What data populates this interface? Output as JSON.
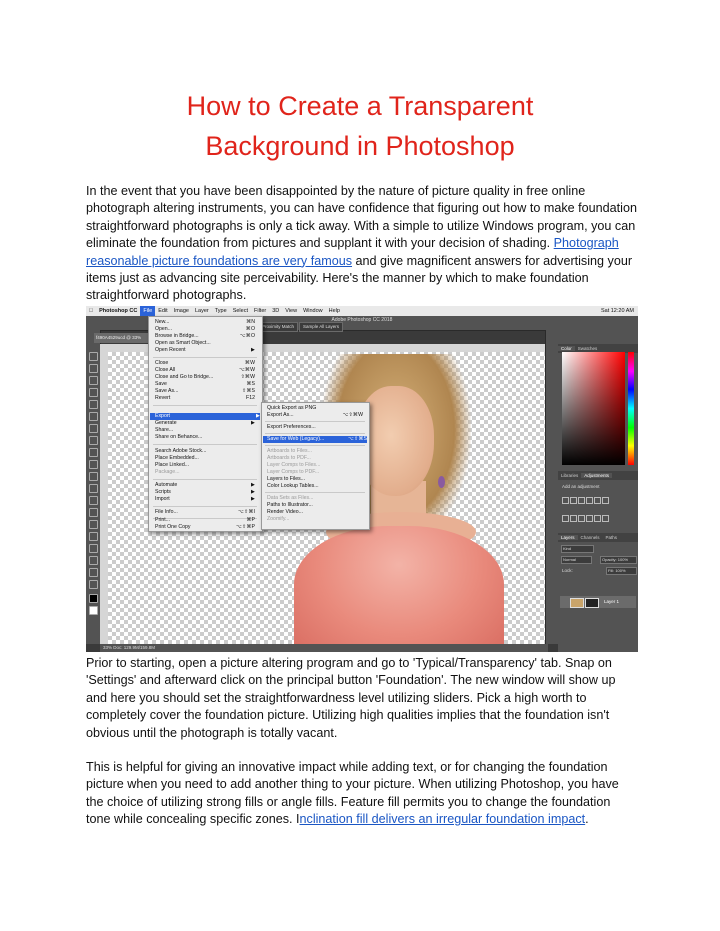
{
  "title_line1": "How to Create a Transparent",
  "title_line2": "Background in Photoshop",
  "para1": {
    "before_link": "In the event that you have been disappointed by the nature of picture quality in free online photograph altering instruments, you can have confidence that figuring out how to make foundation straightforward photographs is only a tick away. With a simple to utilize Windows program, you can eliminate the foundation from pictures and supplant it with your decision of shading. ",
    "link": "Photograph reasonable picture foundations are very famous",
    "after_link": " and give magnificent answers for advertising your items just as advancing site perceivability. Here's the manner by which to make foundation straightforward photographs."
  },
  "para2": "Prior to starting, open a picture altering program and go to 'Typical/Transparency' tab. Snap on 'Settings' and afterward click on the principal button 'Foundation'. The new window will show up and here you should set the straightforwardness level utilizing sliders. Pick a high worth to completely cover the foundation picture. Utilizing high qualities implies that the foundation isn't obvious until the photograph is totally vacant.",
  "para3": {
    "before_link": "This is helpful for giving an innovative impact while adding text, or for changing the foundation picture when you need to add another thing to your picture. When utilizing Photoshop, you have the choice of utilizing strong fills or angle fills. Feature fill permits you to change the foundation tone while concealing specific zones. I",
    "link": "nclination fill delivers an irregular foundation impact",
    "after_link": "."
  },
  "screenshot": {
    "menubar": [
      "Photoshop CC",
      "File",
      "Edit",
      "Image",
      "Layer",
      "Type",
      "Select",
      "Filter",
      "3D",
      "View",
      "Window",
      "Help"
    ],
    "clock": "Sat 12:20 AM",
    "window_title": "Adobe Photoshop CC 2018",
    "opt_proximity": "Proximity Match",
    "opt_sample": "Sample All Layers",
    "doc_tab": "f490A4529ucd @ 33%",
    "status": "33%    Doc: 129.9M/159.8M",
    "file_menu": [
      {
        "label": "New...",
        "shortcut": "⌘N"
      },
      {
        "label": "Open...",
        "shortcut": "⌘O"
      },
      {
        "label": "Browse in Bridge...",
        "shortcut": "⌥⌘O"
      },
      {
        "label": "Open as Smart Object...",
        "shortcut": ""
      },
      {
        "label": "Open Recent",
        "shortcut": "▶"
      },
      {
        "label": "Close",
        "shortcut": "⌘W"
      },
      {
        "label": "Close All",
        "shortcut": "⌥⌘W"
      },
      {
        "label": "Close and Go to Bridge...",
        "shortcut": "⇧⌘W"
      },
      {
        "label": "Save",
        "shortcut": "⌘S"
      },
      {
        "label": "Save As...",
        "shortcut": "⇧⌘S"
      },
      {
        "label": "Revert",
        "shortcut": "F12"
      },
      {
        "label": "Export",
        "shortcut": "▶"
      },
      {
        "label": "Generate",
        "shortcut": "▶"
      },
      {
        "label": "Share...",
        "shortcut": ""
      },
      {
        "label": "Share on Behance...",
        "shortcut": ""
      },
      {
        "label": "Search Adobe Stock...",
        "shortcut": ""
      },
      {
        "label": "Place Embedded...",
        "shortcut": ""
      },
      {
        "label": "Place Linked...",
        "shortcut": ""
      },
      {
        "label": "Package...",
        "shortcut": ""
      },
      {
        "label": "Automate",
        "shortcut": "▶"
      },
      {
        "label": "Scripts",
        "shortcut": "▶"
      },
      {
        "label": "Import",
        "shortcut": "▶"
      },
      {
        "label": "File Info...",
        "shortcut": "⌥⇧⌘I"
      },
      {
        "label": "Print...",
        "shortcut": "⌘P"
      },
      {
        "label": "Print One Copy",
        "shortcut": "⌥⇧⌘P"
      }
    ],
    "export_menu": [
      {
        "label": "Quick Export as PNG",
        "shortcut": ""
      },
      {
        "label": "Export As...",
        "shortcut": "⌥⇧⌘W"
      },
      {
        "label": "Export Preferences...",
        "shortcut": ""
      },
      {
        "label": "Save for Web (Legacy)...",
        "shortcut": "⌥⇧⌘S"
      },
      {
        "label": "Artboards to Files...",
        "shortcut": ""
      },
      {
        "label": "Artboards to PDF...",
        "shortcut": ""
      },
      {
        "label": "Layer Comps to Files...",
        "shortcut": ""
      },
      {
        "label": "Layer Comps to PDF...",
        "shortcut": ""
      },
      {
        "label": "Layers to Files...",
        "shortcut": ""
      },
      {
        "label": "Color Lookup Tables...",
        "shortcut": ""
      },
      {
        "label": "Data Sets as Files...",
        "shortcut": ""
      },
      {
        "label": "Paths to Illustrator...",
        "shortcut": ""
      },
      {
        "label": "Render Video...",
        "shortcut": ""
      },
      {
        "label": "Zoomify...",
        "shortcut": ""
      }
    ],
    "panel_tabs1": [
      "Color",
      "Swatches"
    ],
    "panel_tabs2": [
      "Libraries",
      "Adjustments"
    ],
    "add_adjustment": "Add an adjustment",
    "panel_tabs3": [
      "Layers",
      "Channels",
      "Paths"
    ],
    "layers_kind": "Kind",
    "layers_mode": "Normal",
    "layers_opacity": "Opacity: 100%",
    "layers_lock": "Lock:",
    "layers_fill": "Fill: 100%",
    "layer_name": "Layer 1"
  }
}
